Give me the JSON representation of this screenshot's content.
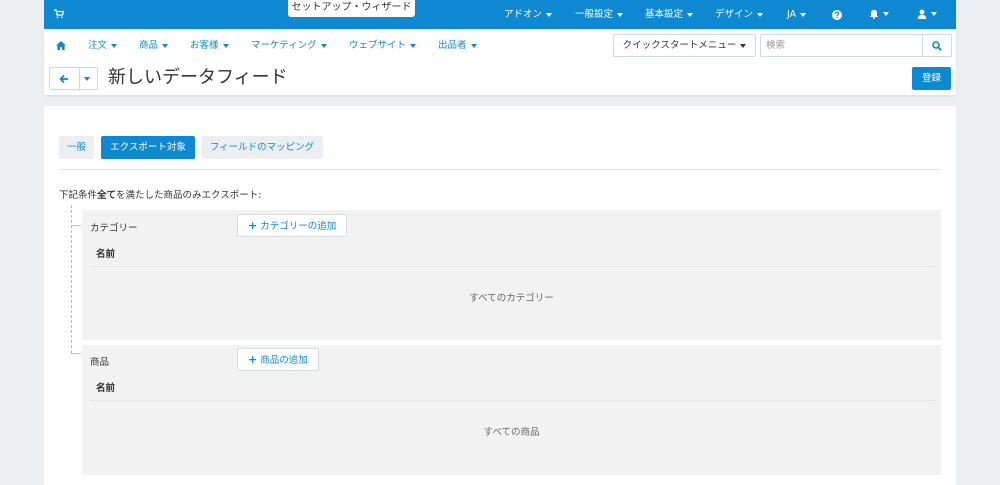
{
  "topbar": {
    "cart_icon": "cart-icon",
    "wizard_label": "セットアップ・ウィザード",
    "menu": [
      {
        "label": "アドオン"
      },
      {
        "label": "一般設定"
      },
      {
        "label": "基本設定"
      },
      {
        "label": "デザイン"
      },
      {
        "label": "JA"
      }
    ],
    "help_icon": "help-icon",
    "bell_icon": "bell-icon",
    "user_icon": "user-icon",
    "color": "#0f88d2"
  },
  "nav": {
    "home_icon": "home-icon",
    "items": [
      {
        "label": "注文"
      },
      {
        "label": "商品"
      },
      {
        "label": "お客様"
      },
      {
        "label": "マーケティング"
      },
      {
        "label": "ウェブサイト"
      },
      {
        "label": "出品者"
      }
    ],
    "quick_start_label": "クイックスタートメニュー",
    "search_placeholder": "検索"
  },
  "header": {
    "title": "新しいデータフィード",
    "save_label": "登録"
  },
  "tabs": [
    {
      "label": "一般",
      "active": false
    },
    {
      "label": "エクスポート対象",
      "active": true
    },
    {
      "label": "フィールドのマッピング",
      "active": false
    }
  ],
  "condition": {
    "prefix": "下記条件",
    "emphasis": "全て",
    "suffix": "を満たした商品のみエクスポート:"
  },
  "categories": {
    "label": "カテゴリー",
    "add_label": "カテゴリーの追加",
    "column_header": "名前",
    "empty_text": "すべてのカテゴリー"
  },
  "products": {
    "label": "商品",
    "add_label": "商品の追加",
    "column_header": "名前",
    "empty_text": "すべての商品"
  }
}
